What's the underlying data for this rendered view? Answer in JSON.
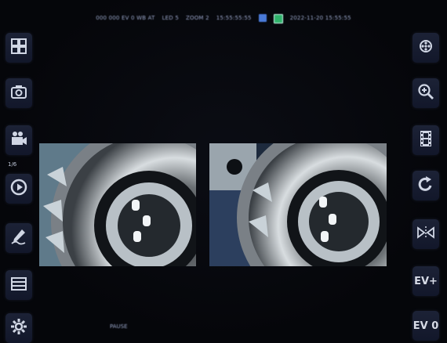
{
  "status_bar": {
    "items": [
      "000 000 EV  0   WB AT",
      "LED 5",
      "ZOOM 2",
      "15:55:55:55",
      "2022-11-20  15:55:55"
    ],
    "indicator_colors": [
      "#4a7bd8",
      "#2fb36a"
    ]
  },
  "left_toolbar": {
    "buttons": [
      {
        "name": "layout-grid",
        "icon": "grid-icon"
      },
      {
        "name": "snapshot",
        "icon": "camera-icon"
      },
      {
        "name": "record",
        "icon": "video-camera-icon"
      },
      {
        "name": "playback",
        "icon": "play-icon"
      },
      {
        "name": "annotate",
        "icon": "pen-icon"
      },
      {
        "name": "split-view",
        "icon": "split-icon"
      },
      {
        "name": "settings",
        "icon": "gear-icon"
      }
    ],
    "playback_caption": "1/6"
  },
  "right_toolbar": {
    "buttons": [
      {
        "name": "led",
        "icon": "light-icon"
      },
      {
        "name": "zoom",
        "icon": "zoom-icon"
      },
      {
        "name": "film",
        "icon": "film-icon"
      },
      {
        "name": "rotate",
        "icon": "rotate-icon"
      },
      {
        "name": "mirror",
        "icon": "mirror-icon"
      },
      {
        "name": "ev-plus",
        "label": "EV+"
      },
      {
        "name": "ev-zero",
        "label": "EV 0"
      }
    ]
  },
  "bottom_caption": "PAUSE",
  "colors": {
    "accent": "#4a7bd8",
    "background": "#05060a",
    "button": "#1a2032"
  }
}
